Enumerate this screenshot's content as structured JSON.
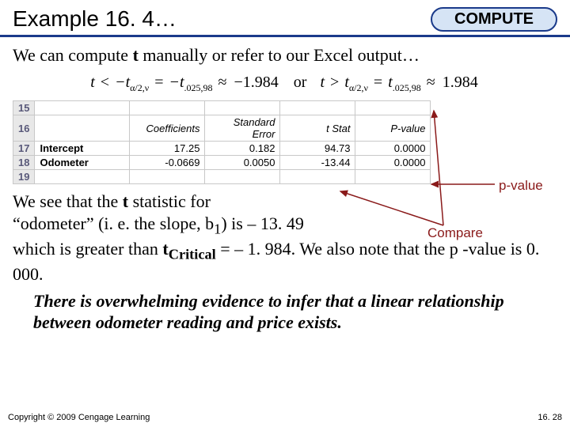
{
  "header": {
    "title": "Example 16. 4…",
    "badge": "COMPUTE"
  },
  "intro": {
    "pre": "We can compute ",
    "bold": "t",
    "post": " manually or refer to our Excel output…"
  },
  "formula": {
    "lhs_t": "t",
    "lt": "<",
    "neg_t": "−t",
    "sub1": "α/2,ν",
    "eq1": "=",
    "neg_t2": "−t",
    "sub2": ".025,98",
    "approx1": "≈",
    "val1": "−1.984",
    "or": "or",
    "gt": ">",
    "pos_t": "t",
    "sub3": "α/2,ν",
    "eq2": "=",
    "pos_t2": "t",
    "sub4": ".025,98",
    "approx2": "≈",
    "val2": "1.984"
  },
  "table": {
    "rows": [
      "15",
      "16",
      "17",
      "18",
      "19"
    ],
    "headers": [
      "",
      "Coefficients",
      "Standard Error",
      "t Stat",
      "P-value"
    ],
    "intercept": {
      "label": "Intercept",
      "coef": "17.25",
      "se": "0.182",
      "t": "94.73",
      "p": "0.0000"
    },
    "odometer": {
      "label": "Odometer",
      "coef": "-0.0669",
      "se": "0.0050",
      "t": "-13.44",
      "p": "0.0000"
    }
  },
  "annot": {
    "pvalue": "p-value",
    "compare": "Compare"
  },
  "conclusion": {
    "l1a": "We see that the ",
    "l1b": "t",
    "l1c": " statistic for",
    "l2a": "“odometer” (i. e. the slope, b",
    "l2sub": "1",
    "l2b": ") is – 13. 49",
    "l3a": "which is greater than ",
    "l3b": "t",
    "l3sub": "Critical",
    "l3c": " = – 1. 984. We also note that the p -value is 0. 000.",
    "italic": "There is overwhelming evidence to infer that a linear relationship between odometer reading and price exists."
  },
  "footer": {
    "copyright": "Copyright © 2009 Cengage Learning",
    "page": "16. 28"
  }
}
